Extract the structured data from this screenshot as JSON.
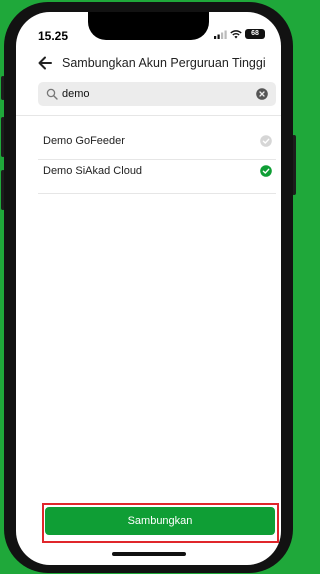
{
  "status_bar": {
    "time": "15.25",
    "battery": "68"
  },
  "header": {
    "title": "Sambungkan Akun Perguruan Tinggi",
    "back_icon": "arrow-left-icon"
  },
  "search": {
    "value": "demo",
    "placeholder": ""
  },
  "list": [
    {
      "label": "Demo GoFeeder",
      "selected": false
    },
    {
      "label": "Demo SiAkad Cloud",
      "selected": true
    }
  ],
  "footer": {
    "connect_label": "Sambungkan"
  },
  "colors": {
    "background": "#1fa83a",
    "primary": "#0f9e35",
    "highlight": "#e0262b"
  }
}
